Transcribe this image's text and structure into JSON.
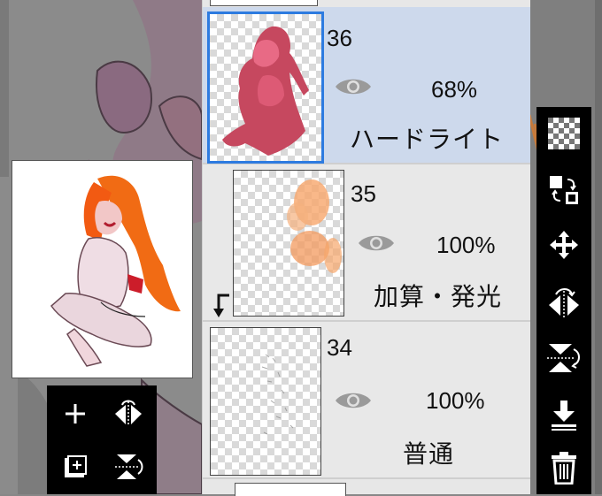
{
  "layers": [
    {
      "number": "36",
      "opacity": "68%",
      "blend": "ハードライト",
      "selected": true
    },
    {
      "number": "35",
      "opacity": "100%",
      "blend": "加算・発光",
      "selected": false
    },
    {
      "number": "34",
      "opacity": "100%",
      "blend": "普通",
      "selected": false
    }
  ],
  "colors": {
    "selected_row": "#cdd9ec",
    "selected_border": "#2d7be0",
    "toolbar": "#000000",
    "panel": "#e7e7e7"
  },
  "icons": {
    "mini_toolbar": [
      "add-layer-icon",
      "flip-horizontal-icon",
      "add-layer-box-icon",
      "flip-vertical-icon"
    ],
    "right_toolbar": [
      "transparency-icon",
      "layer-swap-icon",
      "move-icon",
      "flip-horizontal-icon",
      "flip-vertical-icon",
      "merge-down-icon",
      "delete-icon"
    ]
  }
}
